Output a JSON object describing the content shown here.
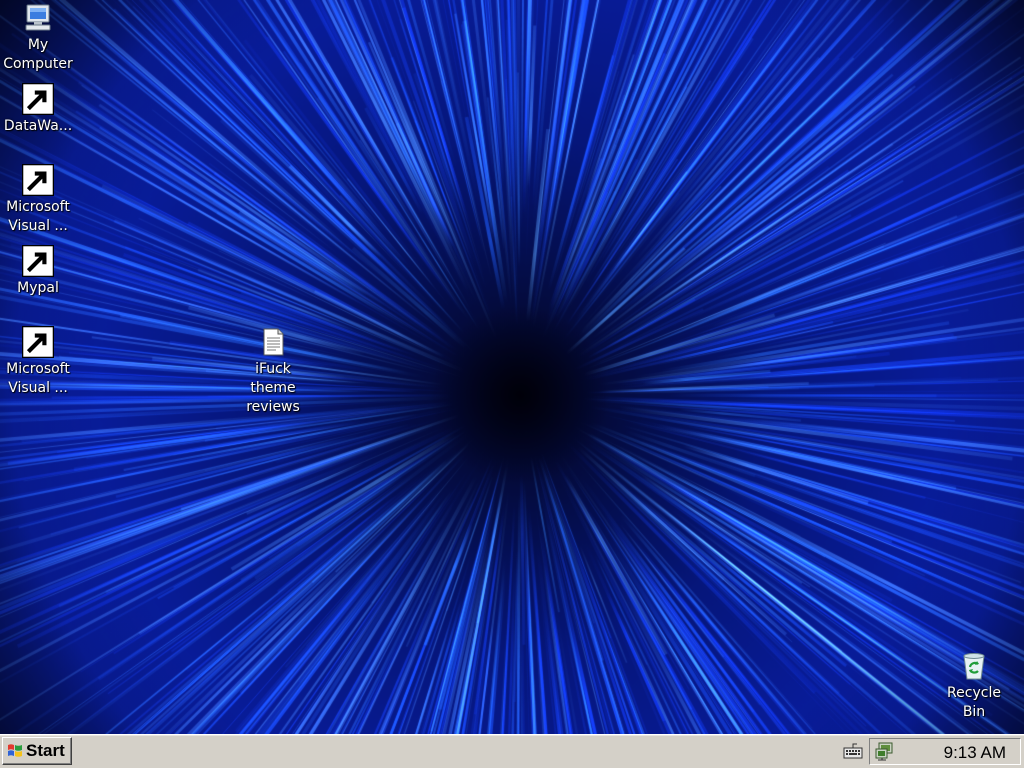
{
  "desktop": {
    "icons": [
      {
        "id": "my-computer",
        "label": "My\nComputer",
        "icon": "my-computer-icon",
        "shortcut": false
      },
      {
        "id": "datawarrior",
        "label": "DataWa...",
        "icon": "datawarrior-icon",
        "shortcut": true
      },
      {
        "id": "ms-visual-1",
        "label": "Microsoft\nVisual ...",
        "icon": "visual-studio-icon",
        "shortcut": true
      },
      {
        "id": "mypal",
        "label": "Mypal",
        "icon": "mypal-raccoon-icon",
        "shortcut": true
      },
      {
        "id": "ms-visual-2",
        "label": "Microsoft\nVisual ...",
        "icon": "visual-foxpro-icon",
        "shortcut": true
      },
      {
        "id": "text-file",
        "label": "iFuck\ntheme\nreviews",
        "icon": "text-document-icon",
        "shortcut": false
      },
      {
        "id": "recycle-bin",
        "label": "Recycle\nBin",
        "icon": "recycle-bin-icon",
        "shortcut": false
      }
    ],
    "wallpaper": "blue-starburst-wallpaper",
    "accent": "#1e6cff"
  },
  "taskbar": {
    "start_label": "Start",
    "tray": {
      "clock": "9:13 AM",
      "icons": [
        "keyboard-icon",
        "network-icon"
      ]
    },
    "background": "#d4d0c8"
  }
}
